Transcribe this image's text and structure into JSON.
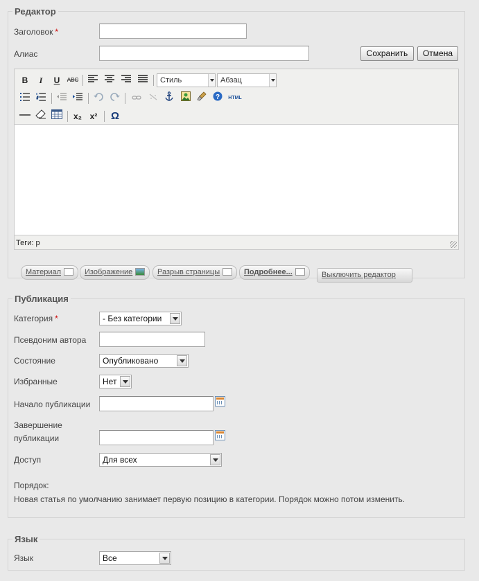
{
  "editor_section": {
    "legend": "Редактор",
    "title_label": "Заголовок",
    "title_required": "*",
    "title_value": "",
    "alias_label": "Алиас",
    "alias_value": "",
    "save_label": "Сохранить",
    "cancel_label": "Отмена",
    "toolbar": {
      "bold": "B",
      "italic": "I",
      "underline": "U",
      "strike": "ABC",
      "style_select": "Стиль",
      "format_select": "Абзац",
      "html": "HTML",
      "sub": "x₂",
      "sup": "x²",
      "omega": "Ω"
    },
    "status_path": "Теги: p",
    "buttons": {
      "article": "Материал",
      "image": "Изображение",
      "pagebreak": "Разрыв страницы",
      "readmore": "Подробнее...",
      "toggle_editor": "Выключить редактор"
    }
  },
  "publishing": {
    "legend": "Публикация",
    "category_label": "Категория",
    "category_required": "*",
    "category_value": "- Без категории",
    "author_alias_label": "Псевдоним автора",
    "author_alias_value": "",
    "state_label": "Состояние",
    "state_value": "Опубликовано",
    "featured_label": "Избранные",
    "featured_value": "Нет",
    "publish_up_label": "Начало публикации",
    "publish_up_value": "",
    "publish_down_label_1": "Завершение",
    "publish_down_label_2": "публикации",
    "publish_down_value": "",
    "access_label": "Доступ",
    "access_value": "Для всех",
    "ordering_label": "Порядок:",
    "ordering_note": "Новая статья по умолчанию занимает первую позицию в категории. Порядок можно потом изменить."
  },
  "language": {
    "legend": "Язык",
    "language_label": "Язык",
    "language_value": "Все"
  }
}
